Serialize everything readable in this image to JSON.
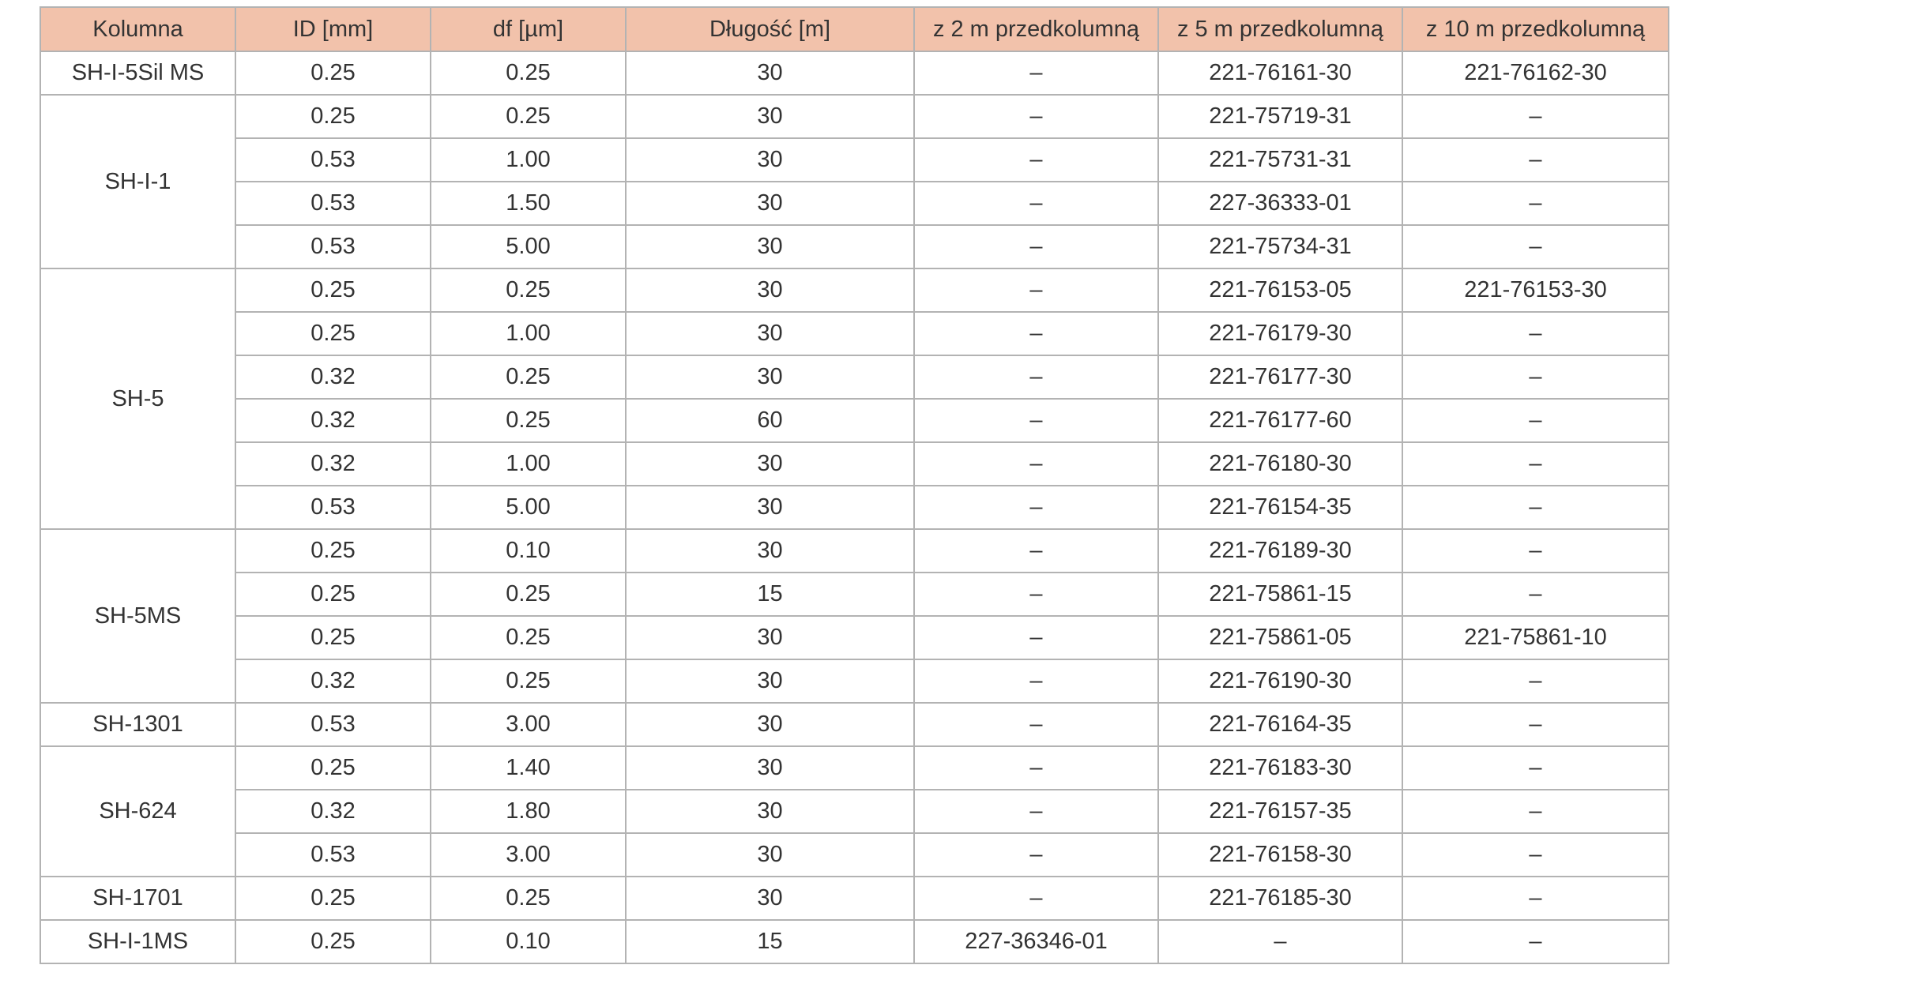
{
  "table": {
    "headers": [
      "Kolumna",
      "ID [mm]",
      "df [µm]",
      "Długość [m]",
      "z 2 m przedkolumną",
      "z 5 m przedkolumną",
      "z 10 m przedkolumną"
    ],
    "groups": [
      {
        "name": "SH-I-5Sil MS",
        "rows": [
          [
            "0.25",
            "0.25",
            "30",
            "–",
            "221-76161-30",
            "221-76162-30"
          ]
        ]
      },
      {
        "name": "SH-I-1",
        "rows": [
          [
            "0.25",
            "0.25",
            "30",
            "–",
            "221-75719-31",
            "–"
          ],
          [
            "0.53",
            "1.00",
            "30",
            "–",
            "221-75731-31",
            "–"
          ],
          [
            "0.53",
            "1.50",
            "30",
            "–",
            "227-36333-01",
            "–"
          ],
          [
            "0.53",
            "5.00",
            "30",
            "–",
            "221-75734-31",
            "–"
          ]
        ]
      },
      {
        "name": "SH-5",
        "rows": [
          [
            "0.25",
            "0.25",
            "30",
            "–",
            "221-76153-05",
            "221-76153-30"
          ],
          [
            "0.25",
            "1.00",
            "30",
            "–",
            "221-76179-30",
            "–"
          ],
          [
            "0.32",
            "0.25",
            "30",
            "–",
            "221-76177-30",
            "–"
          ],
          [
            "0.32",
            "0.25",
            "60",
            "–",
            "221-76177-60",
            "–"
          ],
          [
            "0.32",
            "1.00",
            "30",
            "–",
            "221-76180-30",
            "–"
          ],
          [
            "0.53",
            "5.00",
            "30",
            "–",
            "221-76154-35",
            "–"
          ]
        ]
      },
      {
        "name": "SH-5MS",
        "rows": [
          [
            "0.25",
            "0.10",
            "30",
            "–",
            "221-76189-30",
            "–"
          ],
          [
            "0.25",
            "0.25",
            "15",
            "–",
            "221-75861-15",
            "–"
          ],
          [
            "0.25",
            "0.25",
            "30",
            "–",
            "221-75861-05",
            "221-75861-10"
          ],
          [
            "0.32",
            "0.25",
            "30",
            "–",
            "221-76190-30",
            "–"
          ]
        ]
      },
      {
        "name": "SH-1301",
        "rows": [
          [
            "0.53",
            "3.00",
            "30",
            "–",
            "221-76164-35",
            "–"
          ]
        ]
      },
      {
        "name": "SH-624",
        "rows": [
          [
            "0.25",
            "1.40",
            "30",
            "–",
            "221-76183-30",
            "–"
          ],
          [
            "0.32",
            "1.80",
            "30",
            "–",
            "221-76157-35",
            "–"
          ],
          [
            "0.53",
            "3.00",
            "30",
            "–",
            "221-76158-30",
            "–"
          ]
        ]
      },
      {
        "name": "SH-1701",
        "rows": [
          [
            "0.25",
            "0.25",
            "30",
            "–",
            "221-76185-30",
            "–"
          ]
        ]
      },
      {
        "name": "SH-I-1MS",
        "rows": [
          [
            "0.25",
            "0.10",
            "15",
            "227-36346-01",
            "–",
            "–"
          ]
        ]
      }
    ]
  },
  "colors": {
    "header_bg": "#f2c2ab",
    "border": "#b3b3b3",
    "text": "#333333"
  }
}
